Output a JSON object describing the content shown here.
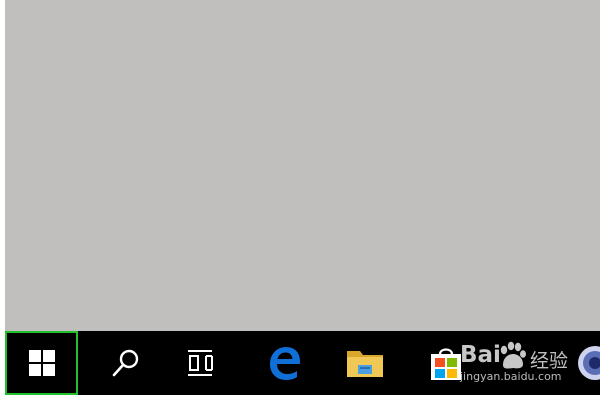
{
  "desktop": {
    "background_color": "#c0bfbd"
  },
  "taskbar": {
    "background_color": "#000000",
    "items": [
      {
        "id": "start",
        "icon": "windows-logo-icon",
        "highlighted": true,
        "highlight_color": "#22c02a"
      },
      {
        "id": "search",
        "icon": "search-icon"
      },
      {
        "id": "task-view",
        "icon": "task-view-icon"
      },
      {
        "id": "edge",
        "icon": "edge-browser-icon",
        "color": "#0f6fd6"
      },
      {
        "id": "file-explorer",
        "icon": "folder-icon",
        "color": "#e9c046"
      },
      {
        "id": "store",
        "icon": "store-bag-icon"
      },
      {
        "id": "cortana",
        "icon": "cortana-icon"
      }
    ]
  },
  "watermark": {
    "brand": "Bai",
    "brand_suffix": "经验",
    "site": "jingyan.baidu.com"
  }
}
